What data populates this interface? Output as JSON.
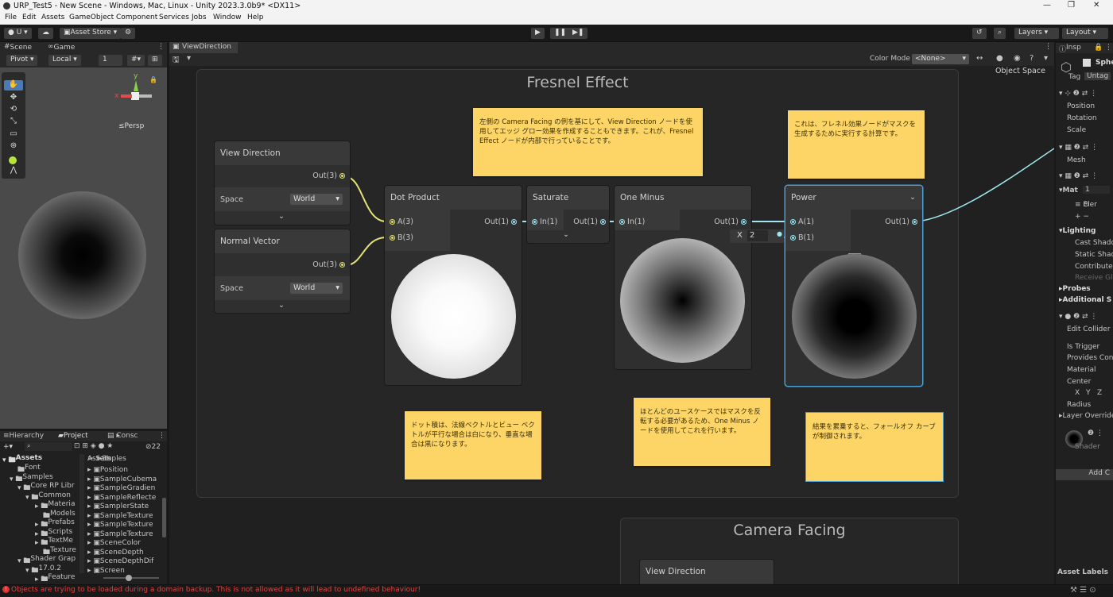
{
  "window": {
    "title": "URP_Test5 - New Scene - Windows, Mac, Linux - Unity 2023.3.0b9* <DX11>"
  },
  "menu": [
    "File",
    "Edit",
    "Assets",
    "GameObject",
    "Component",
    "Services",
    "Jobs",
    "Window",
    "Help"
  ],
  "toolbar": {
    "account": "U",
    "asset_store": "Asset Store",
    "layers": "Layers",
    "layout": "Layout"
  },
  "scene_tabs": {
    "scene": "Scene",
    "game": "Game"
  },
  "scene_toolbar": {
    "pivot": "Pivot",
    "local": "Local",
    "snap": "1"
  },
  "scene_view": {
    "persp": "≤Persp",
    "axis_x": "x",
    "axis_y": "y"
  },
  "graph": {
    "tab": "ViewDirection",
    "color_mode_label": "Color Mode",
    "color_mode_value": "<None>",
    "object_space": "Object Space",
    "group_fresnel": "Fresnel Effect",
    "group_camera": "Camera Facing",
    "nodes": {
      "view_direction": {
        "title": "View Direction",
        "out": "Out(3)",
        "space_label": "Space",
        "space_value": "World"
      },
      "normal_vector": {
        "title": "Normal Vector",
        "out": "Out(3)",
        "space_label": "Space",
        "space_value": "World"
      },
      "dot_product": {
        "title": "Dot Product",
        "a": "A(3)",
        "b": "B(3)",
        "out": "Out(1)"
      },
      "saturate": {
        "title": "Saturate",
        "in": "In(1)",
        "out": "Out(1)"
      },
      "one_minus": {
        "title": "One Minus",
        "in": "In(1)",
        "out": "Out(1)"
      },
      "power": {
        "title": "Power",
        "a": "A(1)",
        "b": "B(1)",
        "out": "Out(1)",
        "b_label": "X",
        "b_value": "2"
      },
      "view_direction_2": {
        "title": "View Direction"
      }
    },
    "stickies": {
      "top": "左側の Camera Facing の例を基にして、View Direction ノードを使用してエッジ グロー効果を作成することもできます。これが、Fresnel Effect ノードが内部で行っていることです。",
      "right_top": "これは、フレネル効果ノードがマスクを生成するために実行する計算です。",
      "dot": "ドット積は、法線ベクトルとビュー ベクトルが平行な場合は白になり、垂直な場合は黒になります。",
      "one_minus": "ほとんどのユースケースではマスクを反転する必要があるため、One Minus ノードを使用してこれを行います。",
      "power": "結果を累乗すると、フォールオフ カーブが制御されます。"
    }
  },
  "inspector": {
    "tab": "Insp",
    "name": "Sphe",
    "tag_label": "Tag",
    "tag_value": "Untag",
    "rows": [
      "Position",
      "Rotation",
      "Scale",
      "Mesh",
      "Mat",
      "1",
      "Eler",
      "Lighting",
      "Cast Shado",
      "Static Shad",
      "Contribute",
      "Receive Glo",
      "Probes",
      "Additional S",
      "Edit Collider",
      "Is Trigger",
      "Provides Cont",
      "Material",
      "Center",
      "X",
      "Y",
      "Z",
      "Radius",
      "Layer Override",
      "Shader",
      "Add C",
      "Asset Labels"
    ]
  },
  "bottom": {
    "tabs": {
      "hierarchy": "Hierarchy",
      "project": "Project",
      "console": "Consc"
    },
    "count": "22",
    "tree": [
      "Assets",
      "Font",
      "Samples",
      "Core RP Libr",
      "Common",
      "Materia",
      "Models",
      "Prefabs",
      "Scripts",
      "TextMe",
      "Texture",
      "Shader Grap",
      "17.0.2",
      "Feature"
    ],
    "breadcrumb": {
      "a": "Assets",
      "b": "Samples",
      "c": "Sh"
    },
    "files": [
      "Position",
      "SampleCubema",
      "SampleGradien",
      "SampleReflecte",
      "SamplerState",
      "SampleTexture",
      "SampleTexture",
      "SampleTexture",
      "SceneColor",
      "SceneDepth",
      "SceneDepthDif",
      "Screen"
    ]
  },
  "status": {
    "error": "Objects are trying to be loaded during a domain backup. This is not allowed as it will lead to undefined behaviour!"
  }
}
